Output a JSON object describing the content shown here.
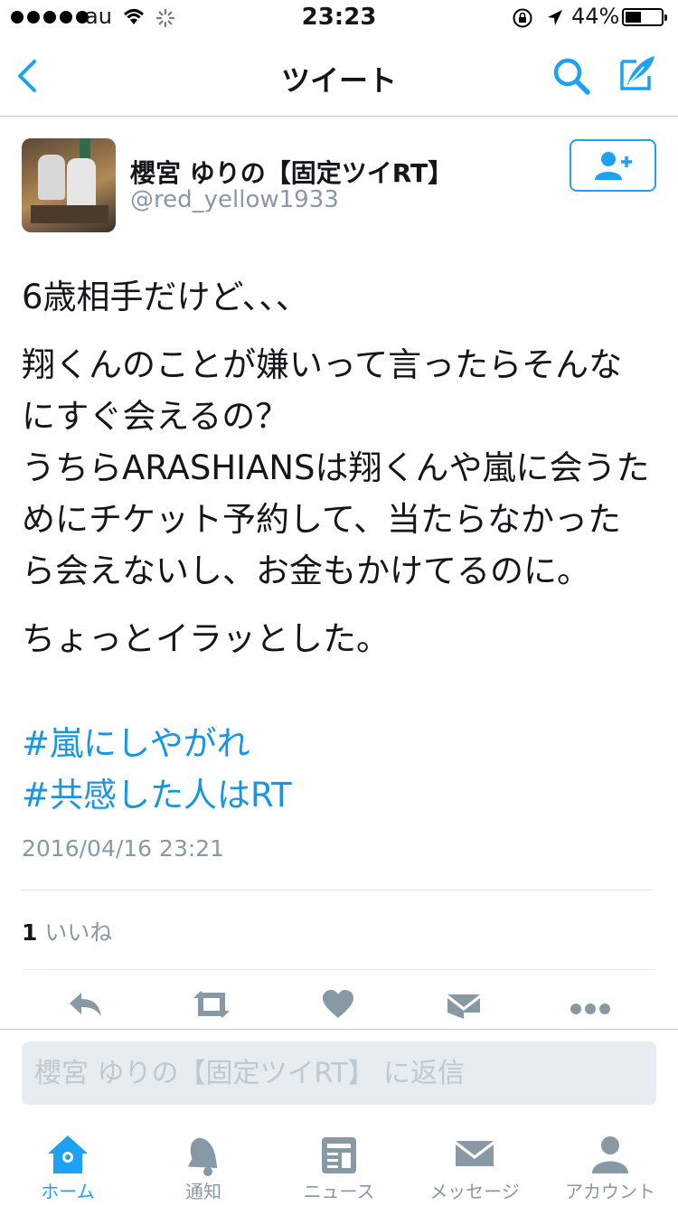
{
  "status_bar": {
    "carrier": "au",
    "time": "23:23",
    "battery_percent": "44%",
    "battery_level": 0.44
  },
  "nav": {
    "title": "ツイート"
  },
  "tweet": {
    "display_name": "櫻宮 ゆりの【固定ツイRT】",
    "handle": "@red_yellow1933",
    "paragraphs": [
      "6歳相手だけど、、、",
      "翔くんのことが嫌いって言ったらそんなにすぐ会えるの？\nうちらARASHIANSは翔くんや嵐に会うためにチケット予約して、当たらなかったら会えないし、お金もかけてるのに。",
      "ちょっとイラッとした。"
    ],
    "hashtags": [
      "#嵐にしやがれ",
      "#共感した人はRT"
    ],
    "timestamp": "2016/04/16 23:21",
    "like_count": "1",
    "like_label": "いいね"
  },
  "reply": {
    "placeholder": "櫻宮 ゆりの【固定ツイRT】 に返信"
  },
  "tabbar": {
    "items": [
      {
        "label": "ホーム",
        "icon": "home-icon",
        "active": true
      },
      {
        "label": "通知",
        "icon": "bell-icon",
        "active": false
      },
      {
        "label": "ニュース",
        "icon": "news-icon",
        "active": false
      },
      {
        "label": "メッセージ",
        "icon": "envelope-icon",
        "active": false
      },
      {
        "label": "アカウント",
        "icon": "person-icon",
        "active": false
      }
    ]
  },
  "colors": {
    "accent": "#1da1f2",
    "hashtag": "#1b95e0",
    "muted": "#8899a6",
    "icon_gray": "#8899a6"
  }
}
